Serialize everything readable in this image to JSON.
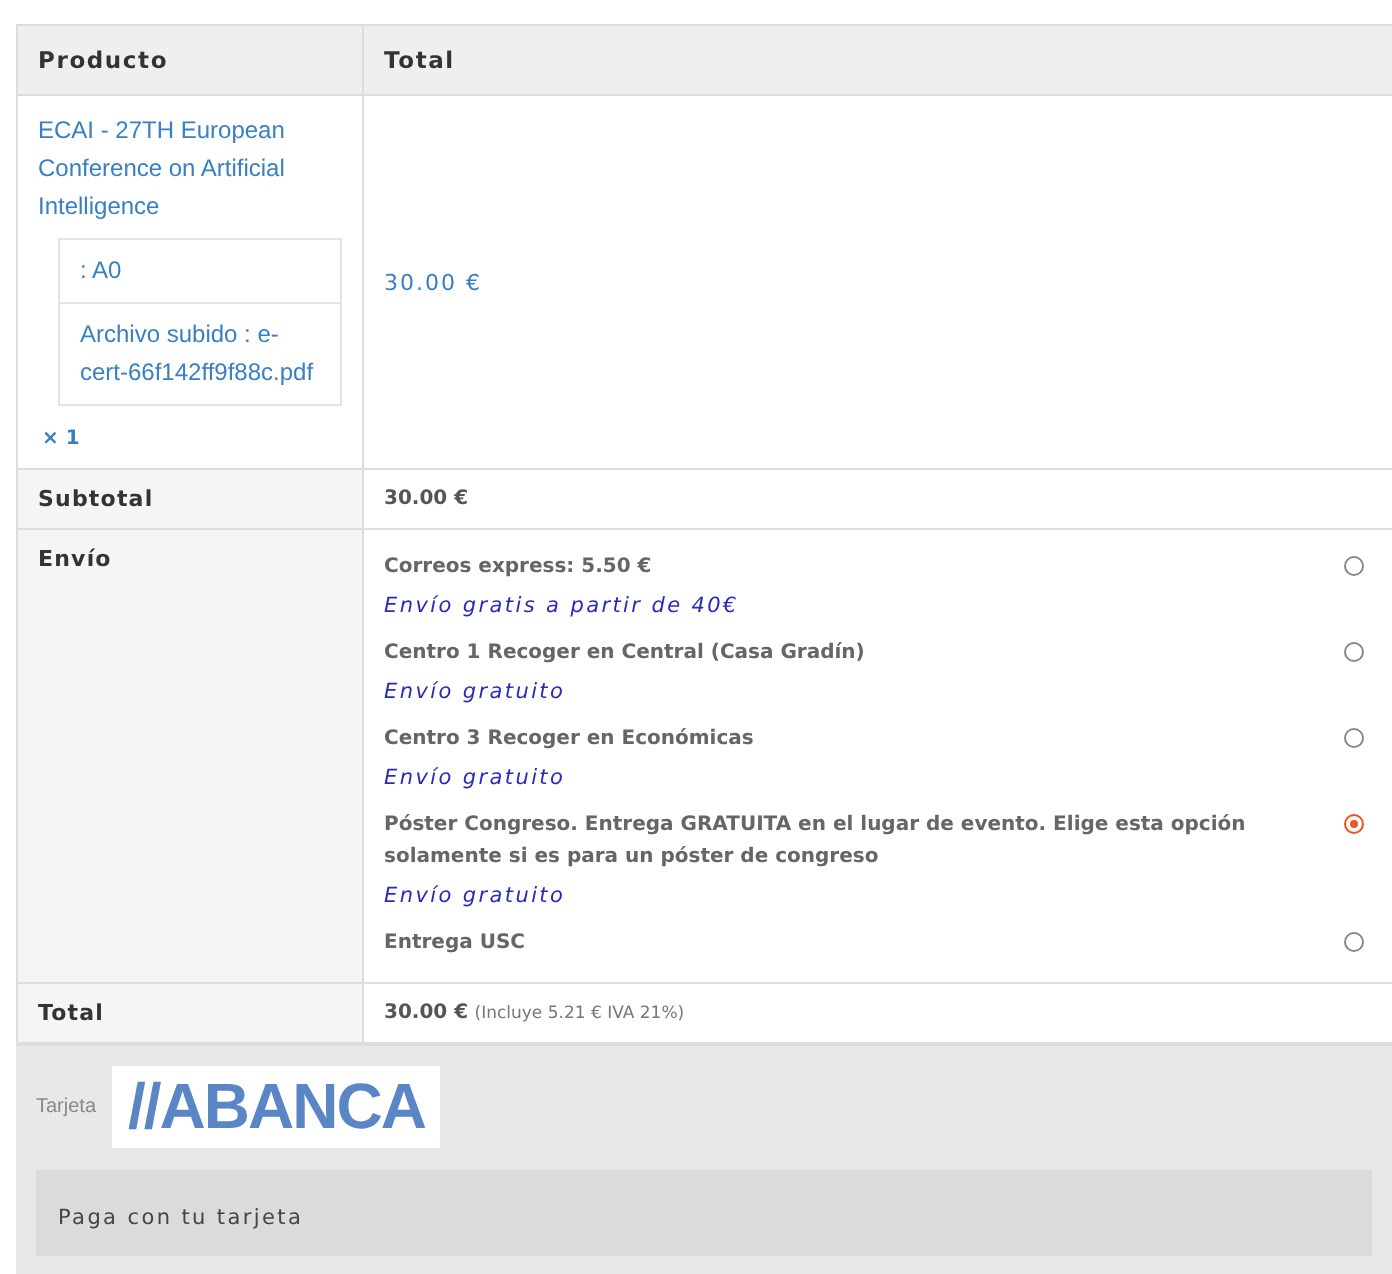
{
  "table": {
    "columns": [
      "Producto",
      "Total"
    ],
    "product": {
      "name": "ECAI - 27TH European Conference on Artificial Intelligence",
      "meta": [
        ": A0",
        "Archivo subido : e-cert-66f142ff9f88c.pdf"
      ],
      "quantity": "× 1",
      "total": "30.00 €"
    },
    "subtotal": {
      "label": "Subtotal",
      "value": "30.00 €"
    },
    "shipping": {
      "label": "Envío",
      "options": [
        {
          "name": "Correos express: 5.50 €",
          "note": "Envío gratis a partir de 40€",
          "selected": false
        },
        {
          "name": "Centro 1 Recoger en Central (Casa Gradín)",
          "note": "Envío gratuito",
          "selected": false
        },
        {
          "name": "Centro 3 Recoger en Económicas",
          "note": "Envío gratuito",
          "selected": false
        },
        {
          "name": "Póster Congreso. Entrega GRATUITA en el lugar de evento. Elige esta opción solamente si es para un póster de congreso",
          "note": "Envío gratuito",
          "selected": true
        },
        {
          "name": "Entrega USC",
          "selected": false
        }
      ]
    },
    "total": {
      "label": "Total",
      "value": "30.00 €",
      "tax": "(Incluye 5.21 € IVA 21%)"
    }
  },
  "payment": {
    "method": "Tarjeta",
    "logo": "//ABANCA",
    "description": "Paga con tu tarjeta"
  }
}
